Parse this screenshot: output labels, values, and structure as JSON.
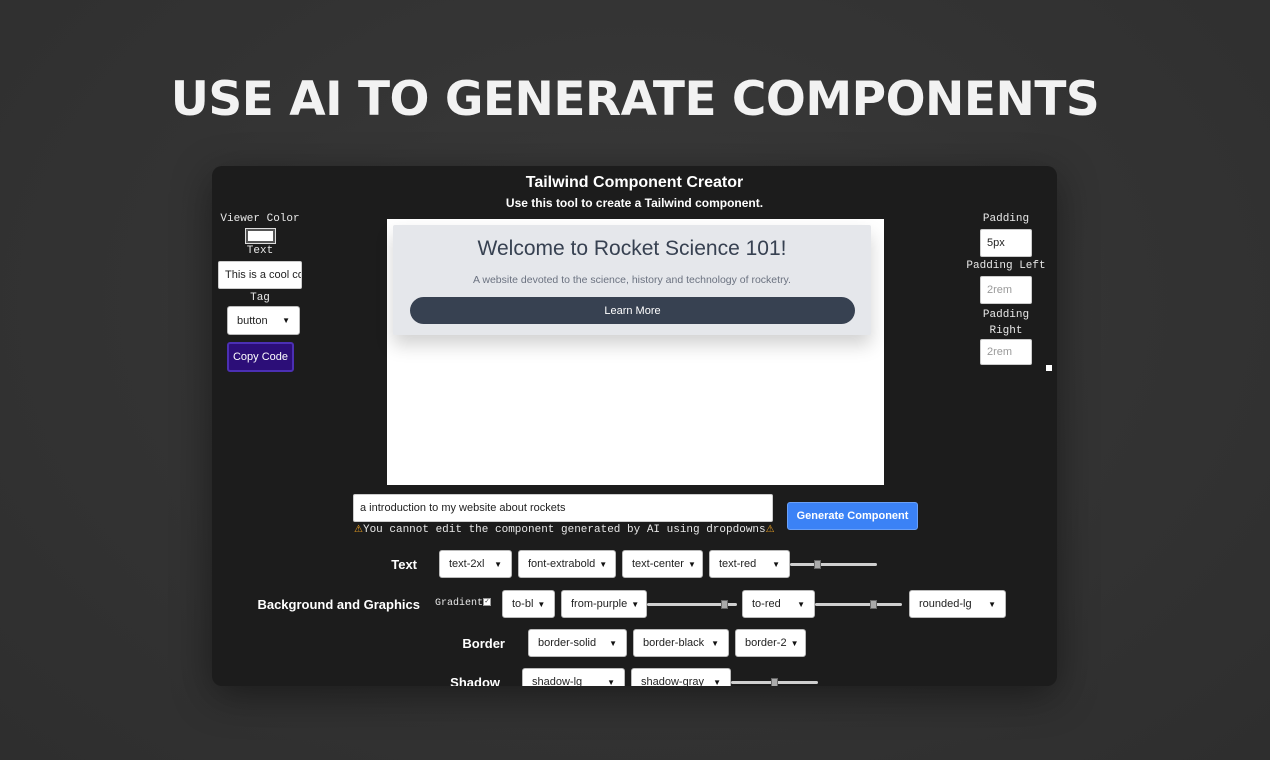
{
  "hero": {
    "title": "USE AI TO GENERATE COMPONENTS"
  },
  "app": {
    "title": "Tailwind Component Creator",
    "subtitle": "Use this tool to create a Tailwind component."
  },
  "left_panel": {
    "viewer_color_label": "Viewer Color",
    "viewer_color_value": "#ffffff",
    "text_label": "Text",
    "text_value": "This is a cool component",
    "tag_label": "Tag",
    "tag_value": "button",
    "copy_button": "Copy Code"
  },
  "right_panel": {
    "padding_label": "Padding",
    "padding_value": "5px",
    "padding_left_label": "Padding Left",
    "padding_left_placeholder": "2rem",
    "padding_right_label": "Padding Right",
    "padding_right_placeholder": "2rem"
  },
  "preview": {
    "heading": "Welcome to Rocket Science 101!",
    "paragraph": "A website devoted to the science, history and technology of rocketry.",
    "button": "Learn More"
  },
  "ai": {
    "prompt_value": "a introduction to my website about rockets",
    "generate_button": "Generate Component",
    "warning": "You cannot edit the component generated by AI using dropdowns"
  },
  "controls": {
    "text": {
      "label": "Text",
      "size": "text-2xl",
      "weight": "font-extrabold",
      "align": "text-center",
      "color": "text-red",
      "color_shade": 0.3
    },
    "background": {
      "label": "Background and Graphics",
      "gradient_label": "Gradient",
      "gradient_checked": true,
      "direction": "to-bl",
      "from": "from-purple",
      "from_shade": 0.9,
      "to": "to-red",
      "to_shade": 0.7,
      "rounded": "rounded-lg"
    },
    "border": {
      "label": "Border",
      "style": "border-solid",
      "color": "border-black",
      "width": "border-2"
    },
    "shadow": {
      "label": "Shadow",
      "size": "shadow-lg",
      "color": "shadow-gray",
      "shade": 0.5
    }
  }
}
